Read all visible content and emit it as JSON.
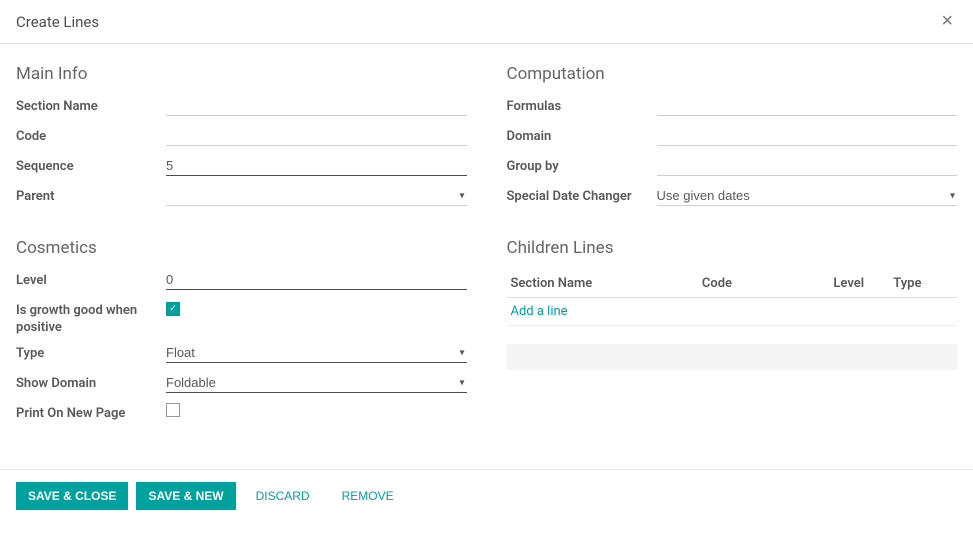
{
  "header": {
    "title": "Create Lines"
  },
  "main_info": {
    "heading": "Main Info",
    "section_name_label": "Section Name",
    "section_name": "",
    "code_label": "Code",
    "code": "",
    "sequence_label": "Sequence",
    "sequence": "5",
    "parent_label": "Parent",
    "parent": ""
  },
  "cosmetics": {
    "heading": "Cosmetics",
    "level_label": "Level",
    "level": "0",
    "is_growth_label": "Is growth good when positive",
    "is_growth_checked": true,
    "type_label": "Type",
    "type": "Float",
    "show_domain_label": "Show Domain",
    "show_domain": "Foldable",
    "print_new_page_label": "Print On New Page",
    "print_new_page_checked": false
  },
  "computation": {
    "heading": "Computation",
    "formulas_label": "Formulas",
    "formulas": "",
    "domain_label": "Domain",
    "domain": "",
    "group_by_label": "Group by",
    "group_by": "",
    "special_date_label": "Special Date Changer",
    "special_date": "Use given dates"
  },
  "children": {
    "heading": "Children Lines",
    "columns": {
      "name": "Section Name",
      "code": "Code",
      "level": "Level",
      "type": "Type"
    },
    "add_link": "Add a line"
  },
  "footer": {
    "save_close": "Save & Close",
    "save_new": "Save & New",
    "discard": "Discard",
    "remove": "Remove"
  }
}
